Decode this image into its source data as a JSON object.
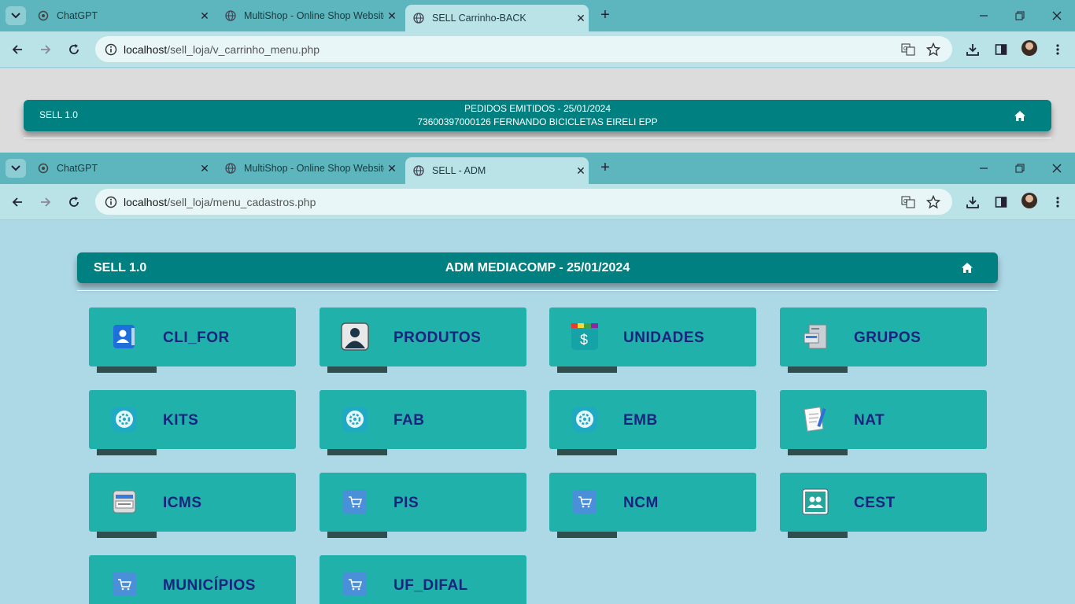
{
  "window1": {
    "tabs": [
      {
        "title": "ChatGPT",
        "active": false
      },
      {
        "title": "MultiShop - Online Shop Website",
        "active": false
      },
      {
        "title": "SELL Carrinho-BACK",
        "active": true
      }
    ],
    "url_host": "localhost",
    "url_path": "/sell_loja/v_carrinho_menu.php",
    "page": {
      "brand": "SELL 1.0",
      "line1": "PEDIDOS EMITIDOS - 25/01/2024",
      "line2": "73600397000126 FERNANDO BICICLETAS EIRELI EPP"
    }
  },
  "window2": {
    "tabs": [
      {
        "title": "ChatGPT",
        "active": false
      },
      {
        "title": "MultiShop - Online Shop Website",
        "active": false
      },
      {
        "title": "SELL - ADM",
        "active": true
      }
    ],
    "url_host": "localhost",
    "url_path": "/sell_loja/menu_cadastros.php",
    "page": {
      "brand": "SELL 1.0",
      "title": "ADM MEDIACOMP - 25/01/2024"
    },
    "menu": [
      {
        "label": "CLI_FOR",
        "icon": "contact-book-icon"
      },
      {
        "label": "PRODUTOS",
        "icon": "user-silhouette-icon"
      },
      {
        "label": "UNIDADES",
        "icon": "dollar-app-icon"
      },
      {
        "label": "GRUPOS",
        "icon": "file-cabinet-icon"
      },
      {
        "label": "KITS",
        "icon": "gear-icon"
      },
      {
        "label": "FAB",
        "icon": "gear-icon"
      },
      {
        "label": "EMB",
        "icon": "gear-icon"
      },
      {
        "label": "NAT",
        "icon": "document-pen-icon"
      },
      {
        "label": "ICMS",
        "icon": "printer-icon"
      },
      {
        "label": "PIS",
        "icon": "cart-icon"
      },
      {
        "label": "NCM",
        "icon": "cart-icon"
      },
      {
        "label": "CEST",
        "icon": "users-icon"
      },
      {
        "label": "MUNICÍPIOS",
        "icon": "cart-icon"
      },
      {
        "label": "UF_DIFAL",
        "icon": "cart-icon"
      }
    ]
  },
  "colors": {
    "header": "#008080",
    "card": "#20b2aa",
    "card_text": "#1a237e",
    "page_bg": "#add8e6"
  }
}
